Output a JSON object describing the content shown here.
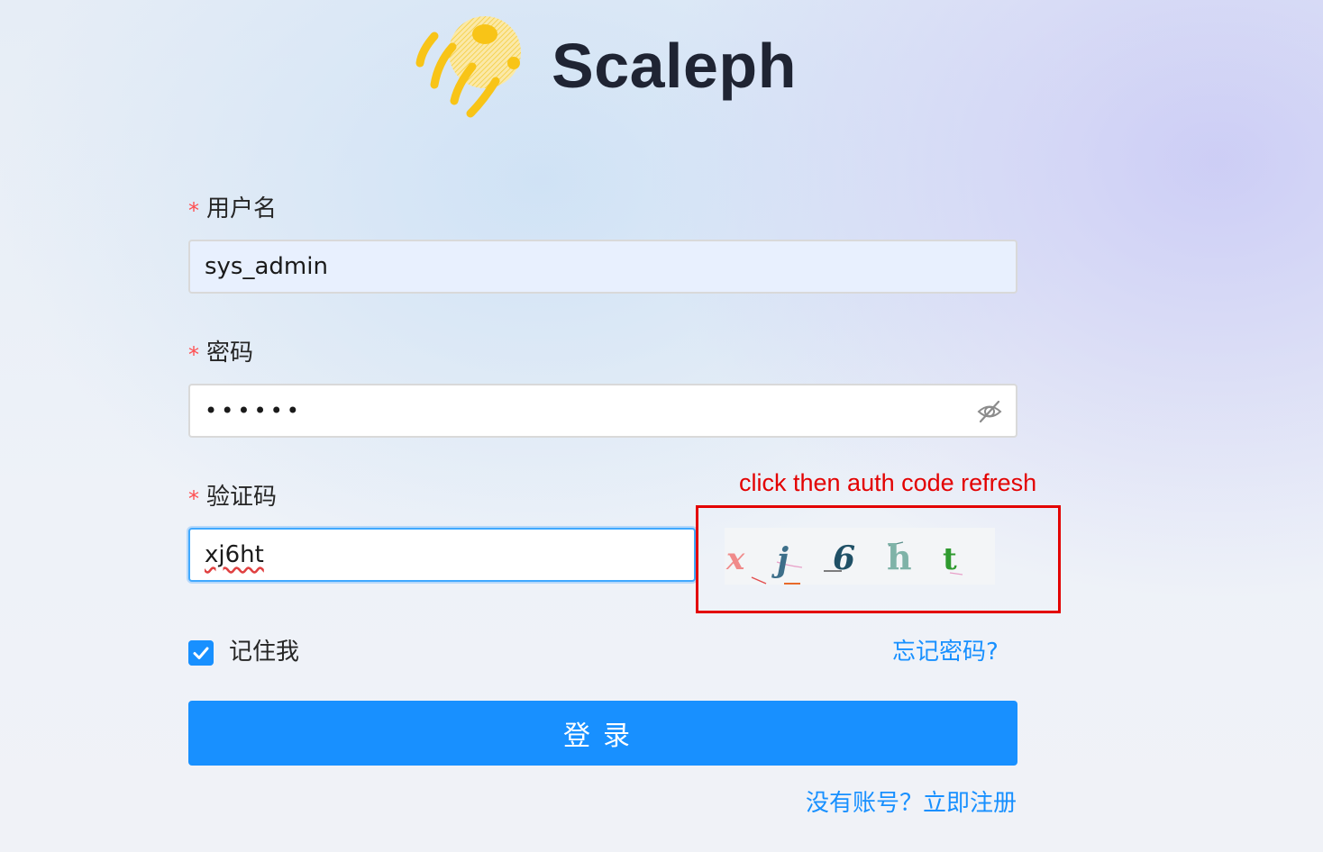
{
  "app": {
    "title": "Scaleph",
    "logo_icon": "jellyfish-logo-icon",
    "brand_color": "#F8C417"
  },
  "form": {
    "username": {
      "label": "用户名",
      "required_mark": "*",
      "value": "sys_admin"
    },
    "password": {
      "label": "密码",
      "required_mark": "*",
      "masked_value": "••••••",
      "toggle_icon": "eye-off-icon"
    },
    "captcha": {
      "label": "验证码",
      "required_mark": "*",
      "value": "xj6ht",
      "image_chars": [
        "x",
        "j",
        "6",
        "h",
        "t"
      ]
    },
    "remember": {
      "label": "记住我",
      "checked": true
    },
    "forgot_label": "忘记密码?",
    "submit_label": "登录",
    "register_label": "没有账号？立即注册"
  },
  "annotation": {
    "text": "click then auth code refresh",
    "color": "#E30000"
  },
  "colors": {
    "primary": "#1890FF",
    "required": "#FF4D4F",
    "text": "#262626"
  }
}
